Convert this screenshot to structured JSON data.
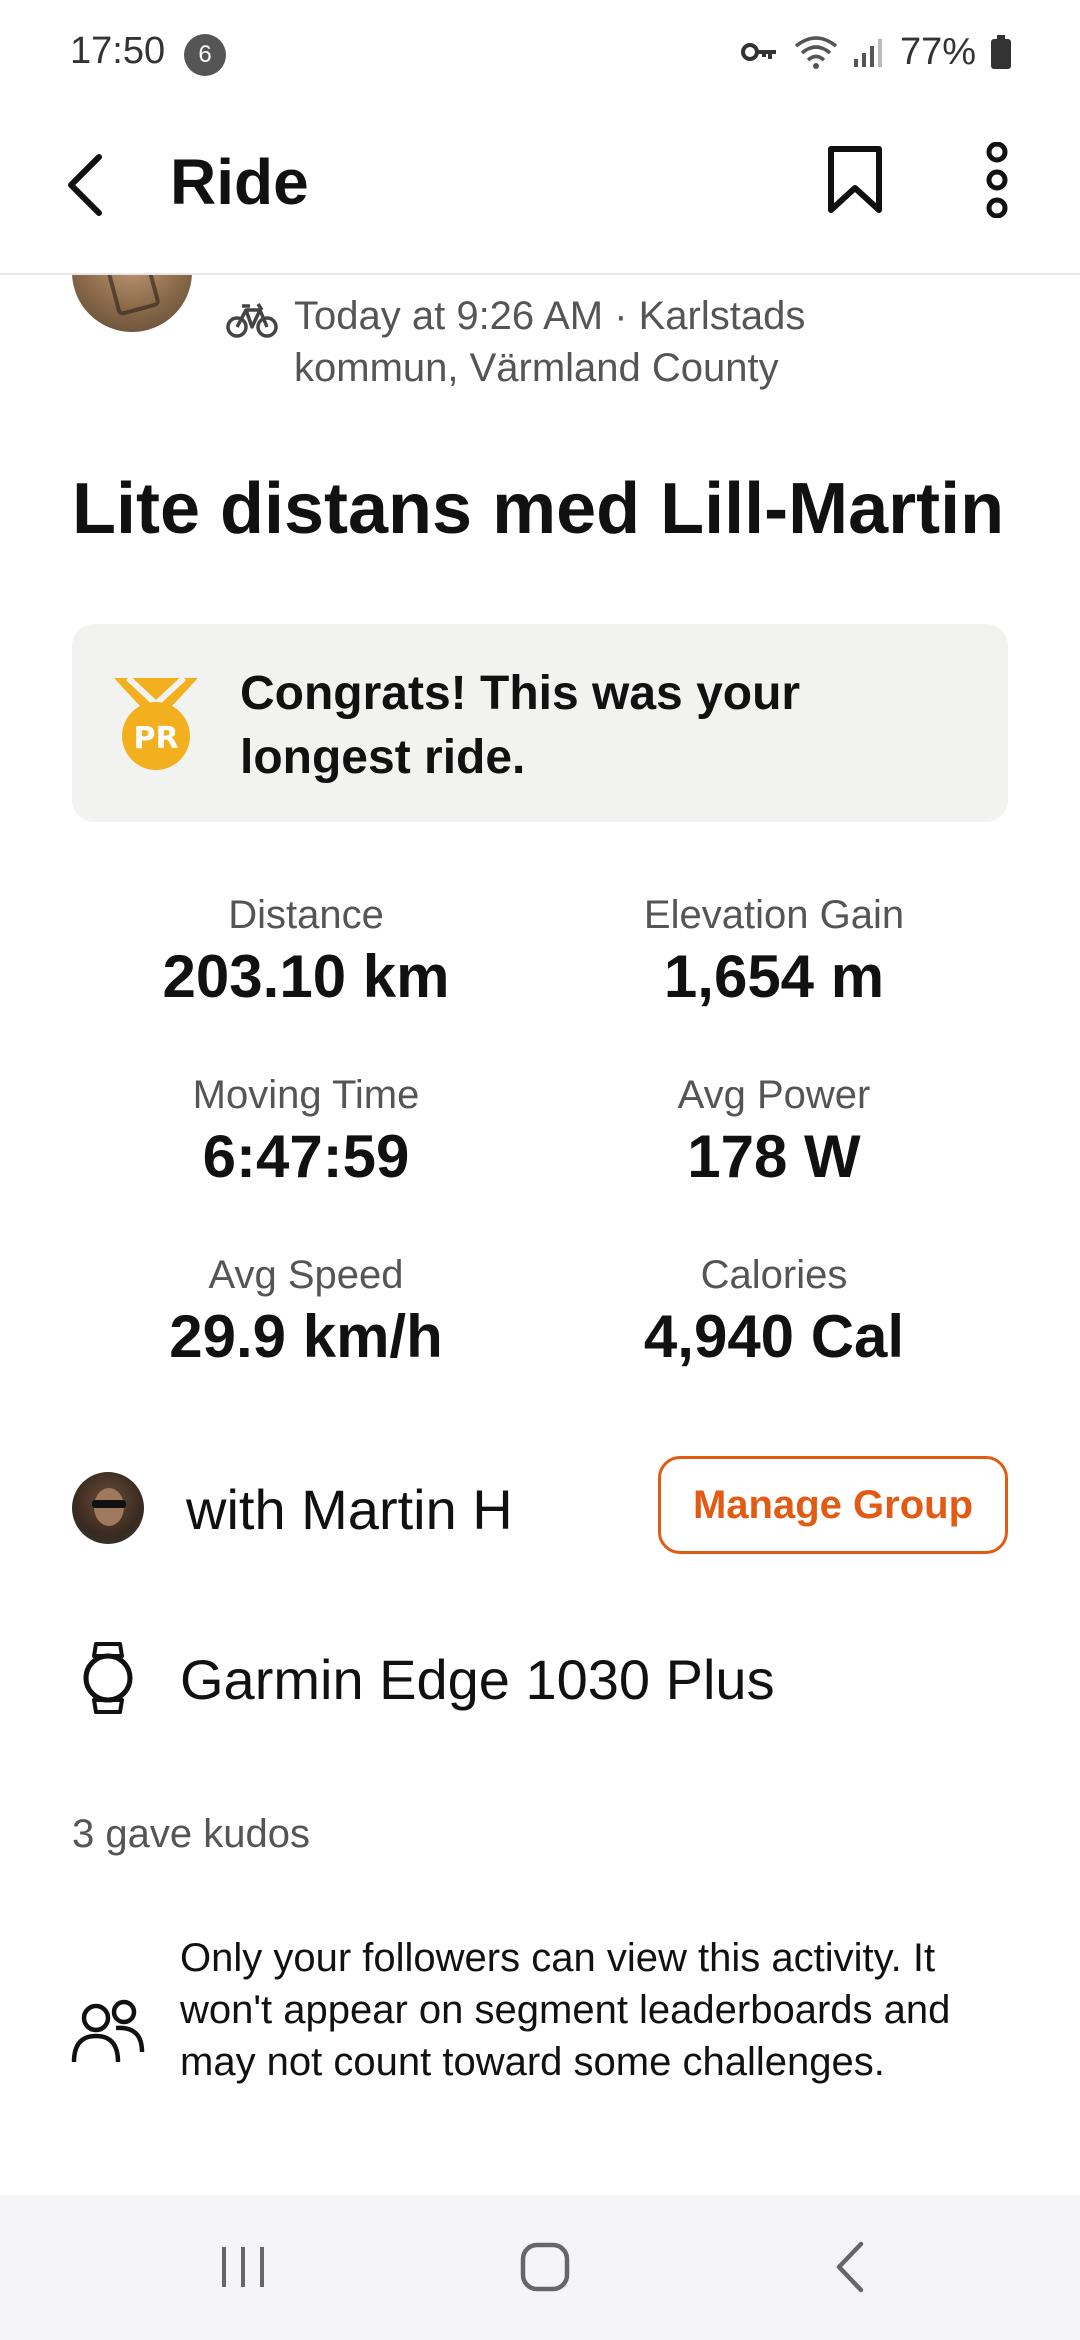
{
  "status_bar": {
    "time": "17:50",
    "notification_count": "6",
    "battery": "77%",
    "icons": [
      "vpn-key-icon",
      "wifi-icon",
      "signal-icon",
      "battery-icon"
    ]
  },
  "app_bar": {
    "title": "Ride",
    "icons": [
      "back-arrow-icon",
      "bookmark-icon",
      "more-vertical-icon"
    ]
  },
  "activity": {
    "meta": "Today at 9:26 AM · Karlstads kommun, Värmland County",
    "title": "Lite distans med Lill-Martin",
    "pr_message": "Congrats! This was your longest ride.",
    "pr_badge_label": "PR"
  },
  "stats": [
    {
      "label": "Distance",
      "value": "203.10 km"
    },
    {
      "label": "Elevation Gain",
      "value": "1,654 m"
    },
    {
      "label": "Moving Time",
      "value": "6:47:59"
    },
    {
      "label": "Avg Power",
      "value": "178 W"
    },
    {
      "label": "Avg Speed",
      "value": "29.9 km/h"
    },
    {
      "label": "Calories",
      "value": "4,940 Cal"
    }
  ],
  "group": {
    "with_text": "with Martin H",
    "manage_label": "Manage Group"
  },
  "device": {
    "name": "Garmin Edge 1030 Plus"
  },
  "kudos": {
    "text": "3 gave kudos"
  },
  "privacy": {
    "text": "Only your followers can view this activity. It won't appear on segment leaderboards and may not count toward some challenges."
  },
  "colors": {
    "accent": "#e35b12",
    "pr_gold": "#f2b01e",
    "banner_bg": "#f2f2f0"
  }
}
